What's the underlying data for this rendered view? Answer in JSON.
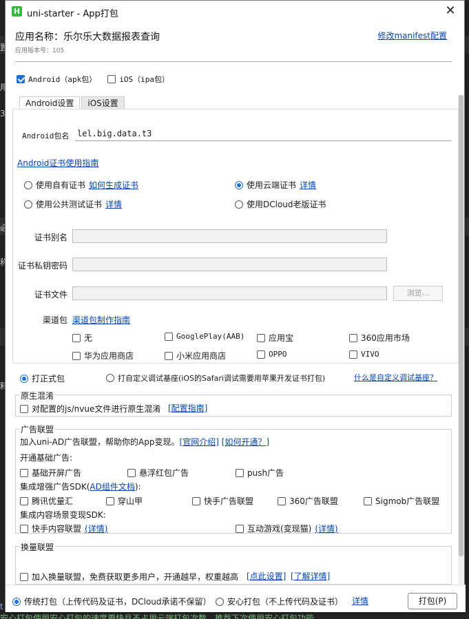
{
  "background": {
    "text_1": "置",
    "text_2": "用",
    "text_3": "3",
    "text_4": "必",
    "text_5": "称",
    "text_6": "释",
    "text_7": "t",
    "footer_text": "安心打包使用安心打包的速度更快且不占用云端打包次数，推荐下次使用安心打包功能"
  },
  "titlebar": {
    "icon_text": "H",
    "title": "uni-starter - App打包",
    "close_glyph": "✕"
  },
  "header": {
    "app_name": "应用名称：乐尔乐大数据报表查询",
    "app_version": "应用版本号：105",
    "manifest_link": "修改manifest配置"
  },
  "platforms": {
    "android": "Android（apk包）",
    "ios": "iOS（ipa包）"
  },
  "tabs": [
    "Android设置",
    "iOS设置"
  ],
  "android": {
    "package_label": "Android包名",
    "package_value": "lel.big.data.t3",
    "cert_guide_link": "Android证书使用指南",
    "cert_options": {
      "own": "使用自有证书",
      "own_link": "如何生成证书",
      "cloud": "使用云端证书",
      "cloud_link": "详情",
      "public_test": "使用公共测试证书",
      "public_test_link": "详情",
      "dcloud_old": "使用DCloud老版证书"
    },
    "alias_label": "证书别名",
    "password_label": "证书私钥密码",
    "file_label": "证书文件",
    "browse_button": "浏览...",
    "channel_label": "渠道包",
    "channel_link": "渠道包制作指南",
    "channels": [
      "无",
      "GooglePlay(AAB)",
      "应用宝",
      "360应用市场",
      "华为应用商店",
      "小米应用商店",
      "OPPO",
      "VIVO"
    ]
  },
  "build_type": {
    "formal": "打正式包",
    "custom_base": "打自定义调试基座(iOS的Safari调试需要用苹果开发证书打包)",
    "custom_base_link": "什么是自定义调试基座？"
  },
  "obfuscation": {
    "title": "原生混淆",
    "option": "对配置的js/nvue文件进行原生混淆",
    "guide_link": "[配置指南]"
  },
  "ad_union": {
    "title": "广告联盟",
    "intro": "加入uni-AD广告联盟，帮助你的App变现。",
    "intro_link_1": "[官网介绍]",
    "intro_link_2": "[如何开通？]",
    "basic_label": "开通基础广告:",
    "basic_options": [
      "基础开屏广告",
      "悬浮红包广告",
      "push广告"
    ],
    "sdk_label_prefix": "集成增强广告SDK(",
    "sdk_label_link": "AD组件文档",
    "sdk_label_suffix": "):",
    "sdk_options": [
      "腾讯优量汇",
      "穿山甲",
      "快手广告联盟",
      "360广告联盟",
      "Sigmob广告联盟"
    ],
    "content_label": "集成内容场景变现SDK:",
    "content_options": [
      {
        "label": "快手内容联盟",
        "link": "(详情)"
      },
      {
        "label": "互动游戏(变现猫)",
        "link": "(详情)"
      }
    ]
  },
  "exchange_union": {
    "title": "换量联盟",
    "option": "加入换量联盟，免费获取更多用户，开通越早，权重越高",
    "link_1": "[点此设置]",
    "link_2": "[了解详情]"
  },
  "bottom": {
    "traditional": "传统打包（上传代码及证书，DCloud承诺不保留）",
    "safe": "安心打包（不上传代码及证书）",
    "details_link": "详情",
    "pack_button": "打包(P)"
  }
}
